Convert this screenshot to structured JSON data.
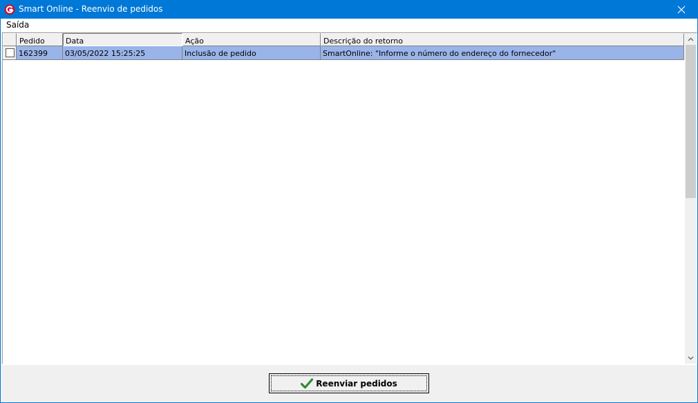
{
  "window": {
    "title": "Smart Online - Reenvio de pedidos"
  },
  "menu": {
    "items": [
      {
        "label": "Saída"
      }
    ]
  },
  "grid": {
    "columns": [
      "Pedido",
      "Data",
      "Ação",
      "Descrição do retorno"
    ],
    "rows": [
      {
        "checked": false,
        "pedido": "162399",
        "data": "03/05/2022 15:25:25",
        "acao": "Inclusão de pedido",
        "descricao": "SmartOnline: \"Informe o número do endereço do fornecedor\""
      }
    ],
    "selection_color": "#99b4e8"
  },
  "actions": {
    "reenviar_label": "Reenviar pedidos"
  },
  "colors": {
    "titlebar": "#0078d7",
    "app_icon": "#c8102e",
    "check": "#2e8b2e"
  },
  "icons": {
    "app": "smart-online-logo-icon",
    "close": "close-icon",
    "confirm": "checkmark-icon"
  }
}
